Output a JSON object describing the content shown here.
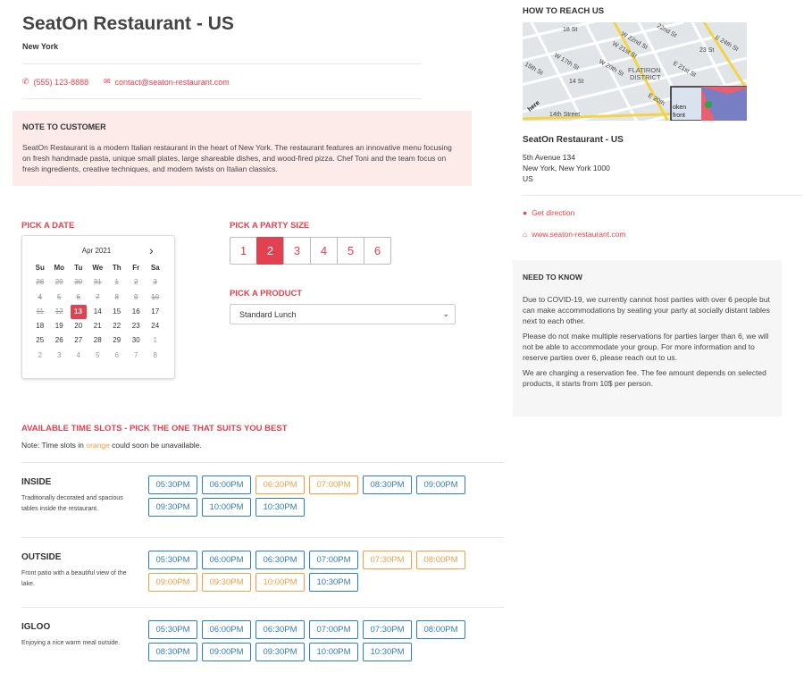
{
  "header": {
    "title": "SeatOn Restaurant - US",
    "city": "New York",
    "phone": "(555) 123-8888",
    "email": "contact@seaton-restaurant.com"
  },
  "note": {
    "heading": "NOTE TO CUSTOMER",
    "body": "SeatOn Restaurant is a modern Italian restaurant in the heart of New York. The restaurant features an innovative menu focusing on fresh handmade pasta, unique small plates, large shareable dishes, and wood-fired pizza. Chef Toni and the team focus on fresh ingredients, creative techniques, and modern twists on Italian classics."
  },
  "date_picker": {
    "label": "PICK A DATE",
    "month": "Apr 2021",
    "days_of_week": [
      "Su",
      "Mo",
      "Tu",
      "We",
      "Th",
      "Fr",
      "Sa"
    ],
    "weeks": [
      [
        "28",
        "29",
        "30",
        "31",
        "1",
        "2",
        "3"
      ],
      [
        "4",
        "5",
        "6",
        "7",
        "8",
        "9",
        "10"
      ],
      [
        "11",
        "12",
        "13",
        "14",
        "15",
        "16",
        "17"
      ],
      [
        "18",
        "19",
        "20",
        "21",
        "22",
        "23",
        "24"
      ],
      [
        "25",
        "26",
        "27",
        "28",
        "29",
        "30",
        "1"
      ],
      [
        "2",
        "3",
        "4",
        "5",
        "6",
        "7",
        "8"
      ]
    ],
    "selected": "13"
  },
  "party": {
    "label": "PICK A PARTY SIZE",
    "options": [
      "1",
      "2",
      "3",
      "4",
      "5",
      "6"
    ],
    "selected": "2"
  },
  "product": {
    "label": "PICK A PRODUCT",
    "selected": "Standard Lunch"
  },
  "timeslots": {
    "heading": "AVAILABLE TIME SLOTS - PICK THE ONE THAT SUITS YOU BEST",
    "note_prefix": "Note: Time slots in ",
    "note_orange": "orange",
    "note_suffix": " could soon be unavailable.",
    "colors": {
      "available": "#2f7dc1",
      "limited": "#f0a040",
      "accent": "#e2414f"
    },
    "areas": [
      {
        "name": "INSIDE",
        "description": "Traditionally decorated and spacious tables inside the restaurant.",
        "slots": [
          {
            "time": "05:30PM",
            "status": "available"
          },
          {
            "time": "06:00PM",
            "status": "available"
          },
          {
            "time": "06:30PM",
            "status": "limited"
          },
          {
            "time": "07:00PM",
            "status": "limited"
          },
          {
            "time": "08:30PM",
            "status": "available"
          },
          {
            "time": "09:00PM",
            "status": "available"
          },
          {
            "time": "09:30PM",
            "status": "available"
          },
          {
            "time": "10:00PM",
            "status": "available"
          },
          {
            "time": "10:30PM",
            "status": "available"
          }
        ]
      },
      {
        "name": "OUTSIDE",
        "description": "Front patio with a beautiful view of the lake.",
        "slots": [
          {
            "time": "05:30PM",
            "status": "available"
          },
          {
            "time": "06:00PM",
            "status": "available"
          },
          {
            "time": "06:30PM",
            "status": "available"
          },
          {
            "time": "07:00PM",
            "status": "available"
          },
          {
            "time": "07:30PM",
            "status": "limited"
          },
          {
            "time": "08:00PM",
            "status": "limited"
          },
          {
            "time": "09:00PM",
            "status": "limited"
          },
          {
            "time": "09:30PM",
            "status": "limited"
          },
          {
            "time": "10:00PM",
            "status": "limited"
          },
          {
            "time": "10:30PM",
            "status": "available"
          }
        ]
      },
      {
        "name": "IGLOO",
        "description": "Enjoying a nice warm meal outside.",
        "slots": [
          {
            "time": "05:30PM",
            "status": "available"
          },
          {
            "time": "06:00PM",
            "status": "available"
          },
          {
            "time": "06:30PM",
            "status": "available"
          },
          {
            "time": "07:00PM",
            "status": "available"
          },
          {
            "time": "07:30PM",
            "status": "available"
          },
          {
            "time": "08:00PM",
            "status": "available"
          },
          {
            "time": "08:30PM",
            "status": "available"
          },
          {
            "time": "09:00PM",
            "status": "available"
          },
          {
            "time": "09:30PM",
            "status": "available"
          },
          {
            "time": "10:00PM",
            "status": "available"
          },
          {
            "time": "10:30PM",
            "status": "available"
          }
        ]
      }
    ]
  },
  "sidebar": {
    "reach_heading": "HOW TO REACH US",
    "map_labels": [
      "18 St",
      "W 22nd St",
      "W 21st St",
      "22nd St",
      "23 St",
      "E 24th St",
      "W 17th St",
      "W 20th St",
      "FLATIRON",
      "DISTRICT",
      "E 21st St",
      "15th St",
      "14 St",
      "14th Street",
      "E 20th",
      "oken",
      "front",
      "here"
    ],
    "name": "SeatOn Restaurant - US",
    "address_lines": [
      "5th Avenue 134",
      "New York, New York 1000",
      "US"
    ],
    "direction_label": "Get direction",
    "website": "www.seaton-restaurant.com",
    "need_to_know": {
      "heading": "NEED TO KNOW",
      "paragraphs": [
        "Due to COVID-19, we currently cannot host parties with over 6 people but can make accommodations by seating your party at socially distant tables next to each other.",
        "Please do not make multiple reservations for parties larger than 6, we will not be able to accommodate your group. For more information and to reserve parties over 6, please reach out to us.",
        "We are charging a reservation fee. The fee amount depends on selected products, it starts from 10$ per person."
      ]
    }
  }
}
